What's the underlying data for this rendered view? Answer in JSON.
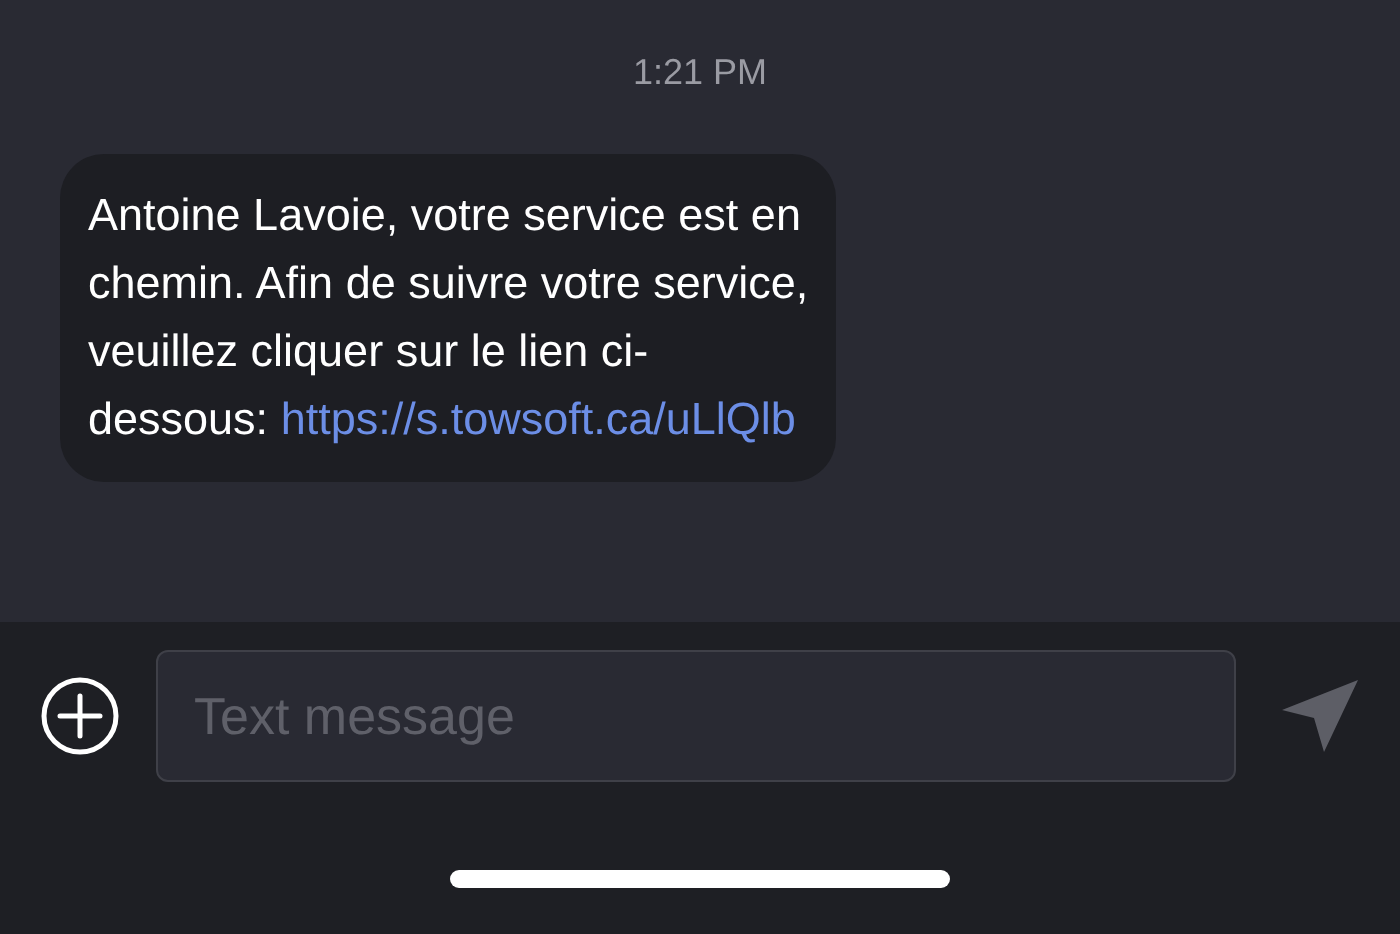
{
  "timestamp": "1:21 PM",
  "message": {
    "text": "Antoine Lavoie, votre service est en chemin. Afin de suivre votre service, veuillez cliquer sur le lien ci-dessous:",
    "link": "https://s.towsoft.ca/uLlQlb"
  },
  "composer": {
    "placeholder": "Text message"
  }
}
